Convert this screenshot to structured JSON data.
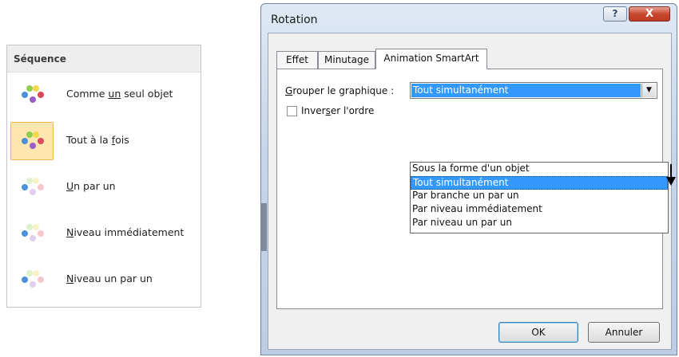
{
  "sequence_panel": {
    "header": "Séquence",
    "items": [
      {
        "pre": "Comme ",
        "u": "un",
        "post": " seul objet",
        "selected": false,
        "faded": false
      },
      {
        "pre": "Tout à la ",
        "u": "f",
        "post": "ois",
        "selected": true,
        "faded": false
      },
      {
        "pre": "",
        "u": "U",
        "post": "n par un",
        "selected": false,
        "faded": true
      },
      {
        "pre": "",
        "u": "N",
        "post": "iveau immédiatement",
        "selected": false,
        "faded": true
      },
      {
        "pre": "",
        "u": "N",
        "post": "iveau un par un",
        "selected": false,
        "faded": true
      }
    ],
    "icon_colors": [
      "#8fcf4f",
      "#f3d84a",
      "#4f8fd8",
      "#d84a5a",
      "#9a5cc6"
    ]
  },
  "dialog": {
    "title": "Rotation",
    "help_glyph": "?",
    "close_glyph": "X",
    "tabs": [
      "Effet",
      "Minutage",
      "Animation SmartArt"
    ],
    "active_tab": "Animation SmartArt",
    "group_label": {
      "u": "G",
      "post": "rouper le graphique :"
    },
    "combo_value": "Tout simultanément",
    "reverse_label": {
      "pre": "Inver",
      "u": "s",
      "post": "er l'ordre"
    },
    "reverse_checked": false,
    "dropdown_options": [
      "Sous la forme d'un objet",
      "Tout simultanément",
      "Par branche un par un",
      "Par niveau immédiatement",
      "Par niveau un par un"
    ],
    "dropdown_selected": "Tout simultanément",
    "ok_label": "OK",
    "cancel_label": "Annuler"
  }
}
